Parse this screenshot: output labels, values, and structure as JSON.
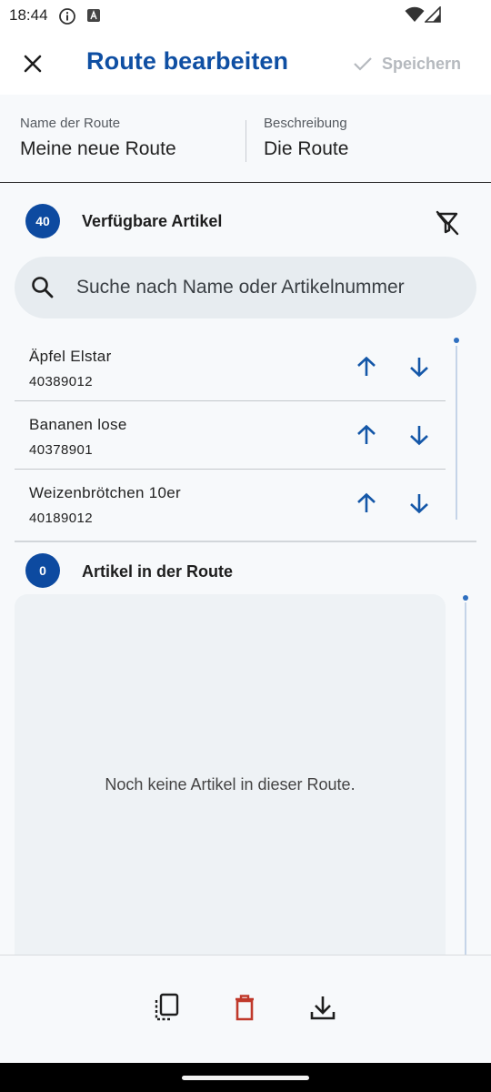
{
  "status_bar": {
    "time": "18:44",
    "icons": [
      "info-circle-icon",
      "a-box-icon",
      "wifi-icon",
      "signal-icon"
    ]
  },
  "app_bar": {
    "title": "Route bearbeiten",
    "close_icon": "close-icon",
    "save_label": "Speichern",
    "save_icon": "check-icon",
    "save_enabled": false
  },
  "form": {
    "name_label": "Name der Route",
    "name_value": "Meine neue Route",
    "description_label": "Beschreibung",
    "description_value": "Die Route"
  },
  "available": {
    "count": "40",
    "title": "Verfügbare Artikel",
    "filter_icon": "filter-off-icon",
    "search_placeholder": "Suche nach Name oder Artikelnummer",
    "items": [
      {
        "name": "Äpfel Elstar",
        "number": "40389012"
      },
      {
        "name": "Bananen lose",
        "number": "40378901"
      },
      {
        "name": "Weizenbrötchen 10er",
        "number": "40189012"
      }
    ]
  },
  "route": {
    "count": "0",
    "title": "Artikel in der Route",
    "empty_text": "Noch keine Artikel in dieser Route."
  },
  "bottom_actions": {
    "icons": [
      "copy-icon",
      "delete-icon",
      "download-icon"
    ]
  },
  "colors": {
    "primary": "#0f4fa3",
    "badge": "#0d4aa0",
    "arrow": "#1457a8",
    "delete": "#c0392b",
    "disabled": "#b5b9be"
  }
}
